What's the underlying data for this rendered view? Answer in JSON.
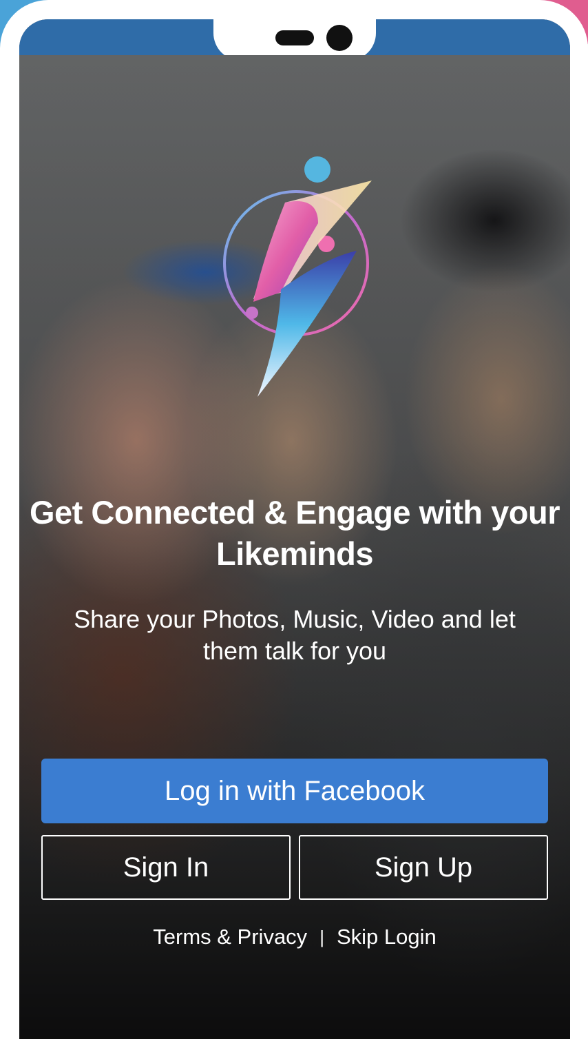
{
  "theme": {
    "status_bar_color": "#2f6ca8",
    "facebook_button_color": "#3b7dd1",
    "text_color": "#ffffff"
  },
  "branding": {
    "logo_icon": "lightning-bolt-logo-icon"
  },
  "hero": {
    "title_line1": "Get Connected & Engage with your",
    "title_line2": "Likeminds",
    "subtitle_line1": "Share your Photos, Music, Video and let",
    "subtitle_line2": "them talk for you"
  },
  "actions": {
    "facebook_label": "Log in with Facebook",
    "signin_label": "Sign In",
    "signup_label": "Sign Up"
  },
  "footer": {
    "terms_label": "Terms & Privacy",
    "separator": "|",
    "skip_label": "Skip Login"
  }
}
